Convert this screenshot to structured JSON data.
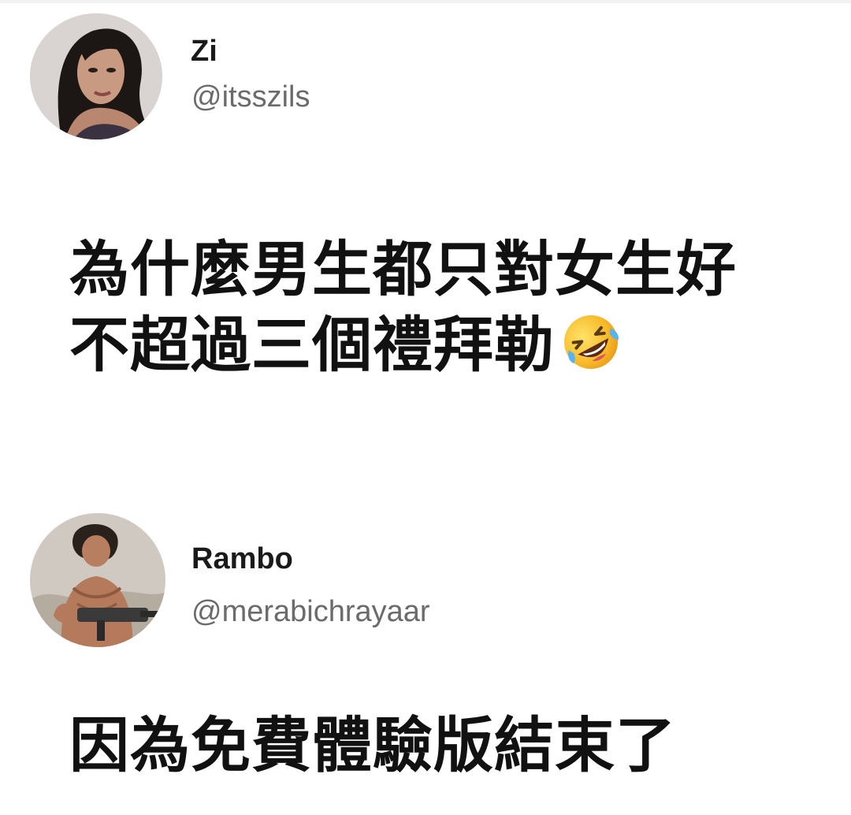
{
  "tweets": [
    {
      "display_name": "Zi",
      "handle": "@itsszils",
      "text_lines": [
        "為什麼男生都只對女生好",
        "不超過三個禮拜勒"
      ],
      "trailing_emoji": "rolling-on-the-floor-laughing",
      "avatar": "woman-portrait"
    },
    {
      "display_name": "Rambo",
      "handle": "@merabichrayaar",
      "text_lines": [
        "因為免費體驗版結束了"
      ],
      "avatar": "man-with-machine-gun"
    }
  ],
  "colors": {
    "background": "#ffffff",
    "name": "#1a1a1a",
    "handle": "#6b6b6b",
    "text": "#111111"
  }
}
